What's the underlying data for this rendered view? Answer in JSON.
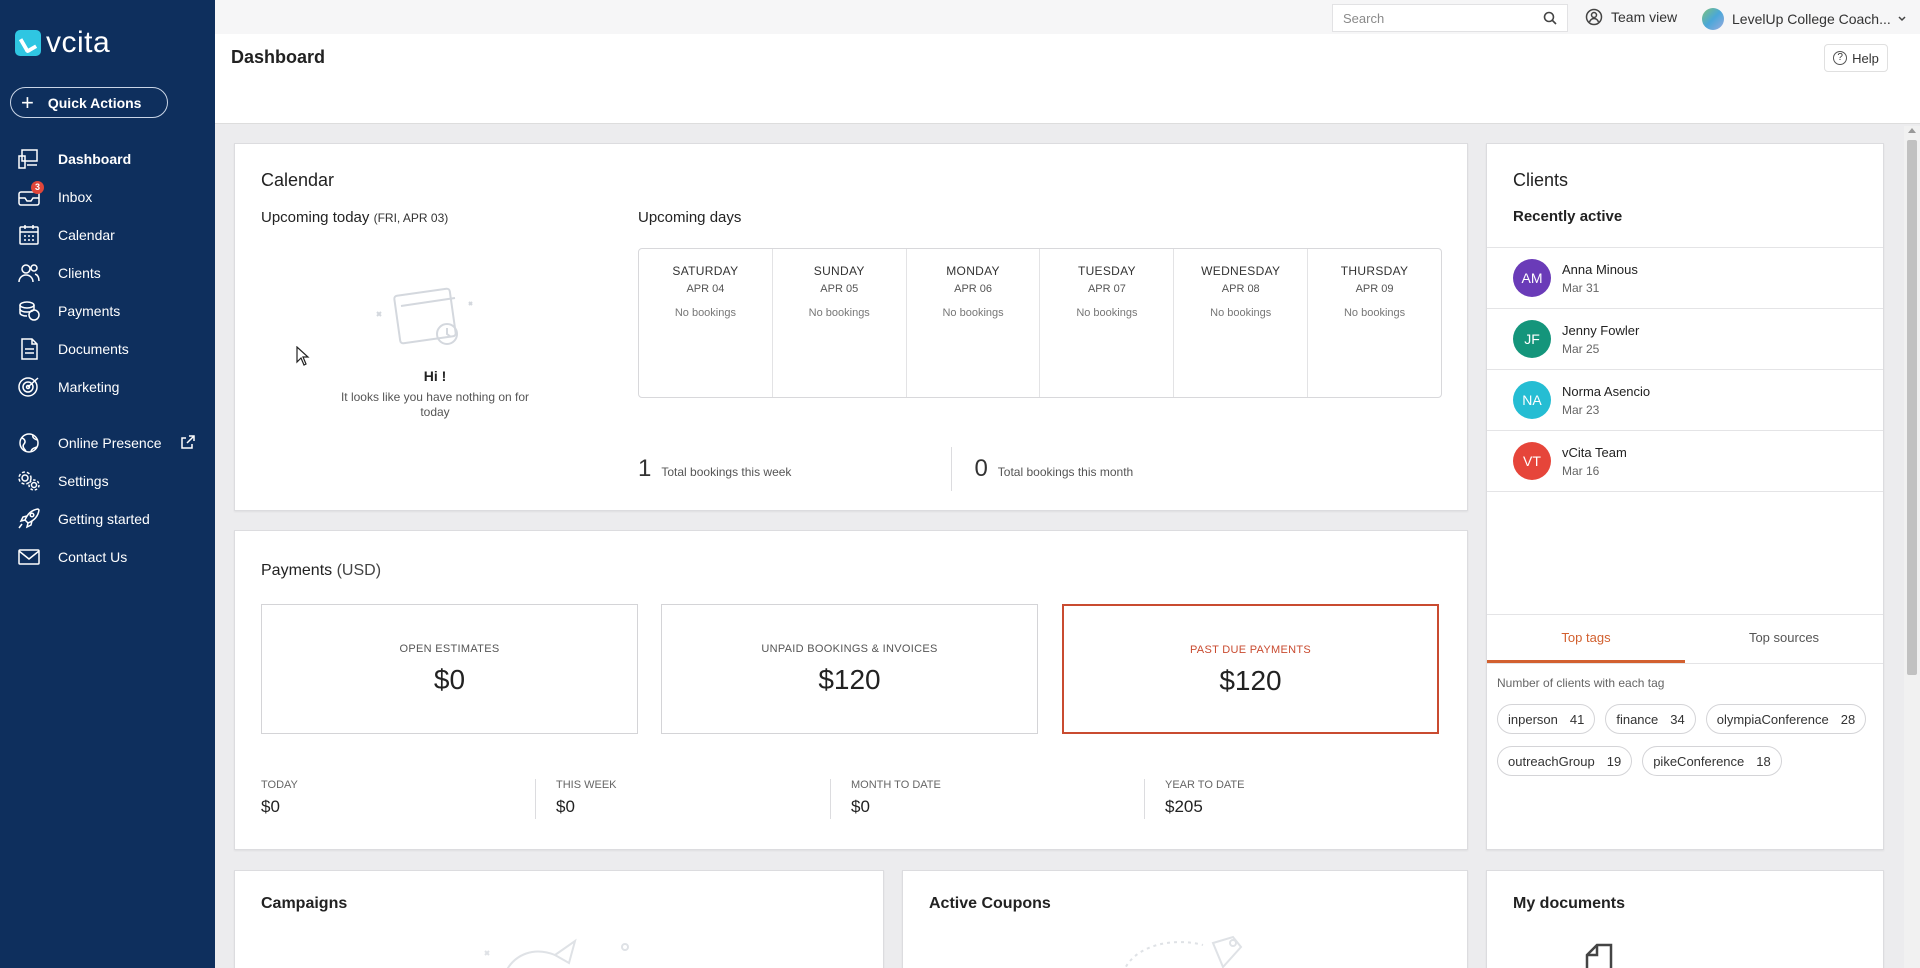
{
  "brand": {
    "name": "vcita",
    "accent": "#2fc6e2",
    "sidebar_bg": "#0e2f5d"
  },
  "sidebar": {
    "quick_actions": "Quick Actions",
    "items": [
      {
        "label": "Dashboard",
        "icon": "dashboard-icon",
        "active": true
      },
      {
        "label": "Inbox",
        "icon": "inbox-icon",
        "badge": "3"
      },
      {
        "label": "Calendar",
        "icon": "calendar-icon"
      },
      {
        "label": "Clients",
        "icon": "clients-icon"
      },
      {
        "label": "Payments",
        "icon": "payments-icon"
      },
      {
        "label": "Documents",
        "icon": "documents-icon"
      },
      {
        "label": "Marketing",
        "icon": "marketing-icon"
      },
      {
        "label": "Online Presence",
        "icon": "globe-icon"
      },
      {
        "label": "Settings",
        "icon": "settings-icon"
      },
      {
        "label": "Getting started",
        "icon": "rocket-icon"
      },
      {
        "label": "Contact Us",
        "icon": "mail-icon"
      }
    ]
  },
  "topbar": {
    "search_placeholder": "Search",
    "team_view": "Team view",
    "account": "LevelUp College Coach..."
  },
  "header": {
    "title": "Dashboard",
    "help": "Help"
  },
  "calendar": {
    "title": "Calendar",
    "upcoming_today": "Upcoming today",
    "today_date": "(FRI, APR 03)",
    "hi": "Hi !",
    "empty_msg": "It looks like you have nothing on for today",
    "upcoming_days": "Upcoming days",
    "days": [
      {
        "name": "SATURDAY",
        "date": "APR 04",
        "status": "No bookings"
      },
      {
        "name": "SUNDAY",
        "date": "APR 05",
        "status": "No bookings"
      },
      {
        "name": "MONDAY",
        "date": "APR 06",
        "status": "No bookings"
      },
      {
        "name": "TUESDAY",
        "date": "APR 07",
        "status": "No bookings"
      },
      {
        "name": "WEDNESDAY",
        "date": "APR 08",
        "status": "No bookings"
      },
      {
        "name": "THURSDAY",
        "date": "APR 09",
        "status": "No bookings"
      }
    ],
    "week_total": "1",
    "week_label": "Total bookings this week",
    "month_total": "0",
    "month_label": "Total bookings this month"
  },
  "payments": {
    "title": "Payments",
    "currency": "(USD)",
    "boxes": [
      {
        "label": "OPEN ESTIMATES",
        "value": "$0"
      },
      {
        "label": "UNPAID BOOKINGS & INVOICES",
        "value": "$120"
      },
      {
        "label": "PAST DUE PAYMENTS",
        "value": "$120",
        "color": "#c94b30"
      }
    ],
    "periods": [
      {
        "label": "TODAY",
        "value": "$0"
      },
      {
        "label": "THIS WEEK",
        "value": "$0"
      },
      {
        "label": "MONTH TO DATE",
        "value": "$0"
      },
      {
        "label": "YEAR TO DATE",
        "value": "$205"
      }
    ]
  },
  "clients": {
    "title": "Clients",
    "subtitle": "Recently active",
    "list": [
      {
        "initials": "AM",
        "name": "Anna Minous",
        "date": "Mar 31",
        "color": "#6a3bb8"
      },
      {
        "initials": "JF",
        "name": "Jenny Fowler",
        "date": "Mar 25",
        "color": "#14957b"
      },
      {
        "initials": "NA",
        "name": "Norma Asencio",
        "date": "Mar 23",
        "color": "#25bdd3"
      },
      {
        "initials": "VT",
        "name": "vCita Team",
        "date": "Mar 16",
        "color": "#e6453a"
      }
    ],
    "tabs": [
      "Top tags",
      "Top sources"
    ],
    "tag_note": "Number of clients with each tag",
    "tags": [
      {
        "name": "inperson",
        "count": "41"
      },
      {
        "name": "finance",
        "count": "34"
      },
      {
        "name": "olympiaConference",
        "count": "28"
      },
      {
        "name": "outreachGroup",
        "count": "19"
      },
      {
        "name": "pikeConference",
        "count": "18"
      }
    ]
  },
  "bottom": {
    "campaigns": "Campaigns",
    "coupons": "Active Coupons",
    "documents": "My documents"
  }
}
